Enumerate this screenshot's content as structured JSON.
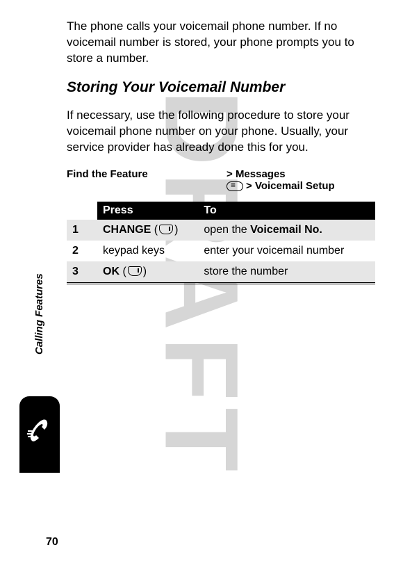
{
  "watermark": "DRAFT",
  "intro_para": "The phone calls your voicemail phone number. If no voicemail number is stored, your phone prompts you to store a number.",
  "heading": "Storing Your Voicemail Number",
  "body_para": "If necessary, use the following procedure to store your voicemail phone number on your phone. Usually, your service provider has already done this for you.",
  "find_label": "Find the Feature",
  "nav": {
    "line1_prefix": ">",
    "line1": "Messages",
    "line2_prefix": ">",
    "line2": "Voicemail Setup"
  },
  "table": {
    "head_press": "Press",
    "head_to": "To",
    "rows": [
      {
        "n": "1",
        "press_key": "CHANGE",
        "press_suffix": "(",
        "press_close": ")",
        "to_pre": "open the ",
        "to_key": "Voicemail No.",
        "to_post": ""
      },
      {
        "n": "2",
        "press_plain": "keypad keys",
        "to_plain": "enter your voicemail number"
      },
      {
        "n": "3",
        "press_key": "OK",
        "press_suffix": "(",
        "press_close": ")",
        "to_plain": "store the number"
      }
    ]
  },
  "side_label": "Calling Features",
  "page_number": "70"
}
